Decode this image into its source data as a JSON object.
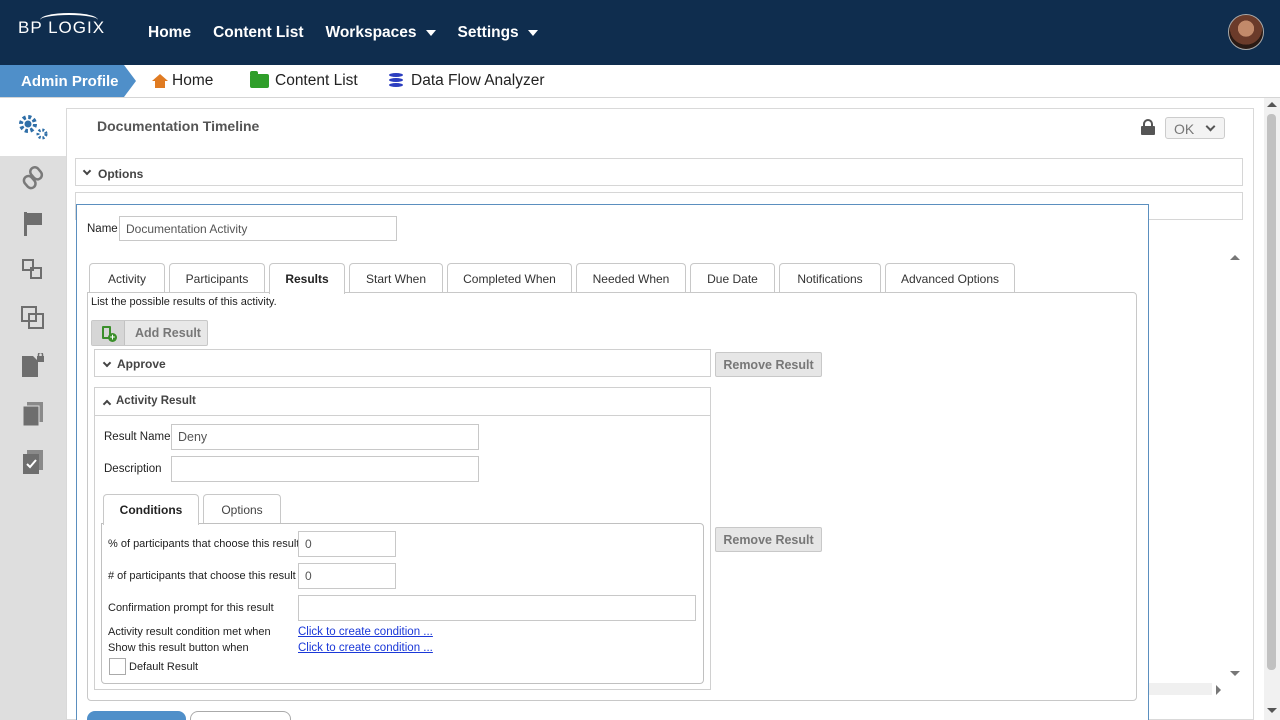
{
  "topnav": {
    "logo": "BP LOGIX",
    "items": [
      {
        "label": "Home",
        "has_dropdown": false
      },
      {
        "label": "Content List",
        "has_dropdown": false
      },
      {
        "label": "Workspaces",
        "has_dropdown": true
      },
      {
        "label": "Settings",
        "has_dropdown": true
      }
    ]
  },
  "breadcrumb": {
    "profile": "Admin Profile",
    "items": [
      {
        "label": "Home",
        "icon": "home-icon"
      },
      {
        "label": "Content List",
        "icon": "folder-icon"
      },
      {
        "label": "Data Flow Analyzer",
        "icon": "database-icon"
      }
    ]
  },
  "sidebar": {
    "icons": [
      "gears-icon",
      "link-icon",
      "flag-icon",
      "copy-structure-icon",
      "layers-icon",
      "locked-document-icon",
      "documents-icon",
      "checklist-icon"
    ]
  },
  "page": {
    "title": "Documentation Timeline",
    "ok_label": "OK",
    "options_label": "Options"
  },
  "dialog": {
    "name_label": "Name",
    "name_value": "Documentation Activity",
    "tabs": [
      "Activity",
      "Participants",
      "Results",
      "Start When",
      "Completed When",
      "Needed When",
      "Due Date",
      "Notifications",
      "Advanced Options"
    ],
    "active_tab": "Results",
    "results_hint": "List the possible results of this activity.",
    "add_result_label": "Add Result",
    "remove_result_label": "Remove Result",
    "results": [
      {
        "title": "Approve",
        "expanded": false
      },
      {
        "title": "Activity Result",
        "expanded": true
      }
    ],
    "result_form": {
      "result_name_label": "Result Name",
      "result_name_value": "Deny",
      "description_label": "Description",
      "description_value": "",
      "subtabs": [
        "Conditions",
        "Options"
      ],
      "active_subtab": "Conditions",
      "percent_label": "% of participants that choose this result",
      "percent_value": "0",
      "count_label": "# of participants that choose this result",
      "count_value": "0",
      "confirmation_label": "Confirmation prompt for this result",
      "confirmation_value": "",
      "condition_met_label": "Activity result condition met when",
      "condition_met_link": "Click to create condition ...",
      "show_button_label": "Show this result button when",
      "show_button_link": "Click to create condition ...",
      "default_result_label": "Default Result",
      "default_result_checked": false
    }
  }
}
